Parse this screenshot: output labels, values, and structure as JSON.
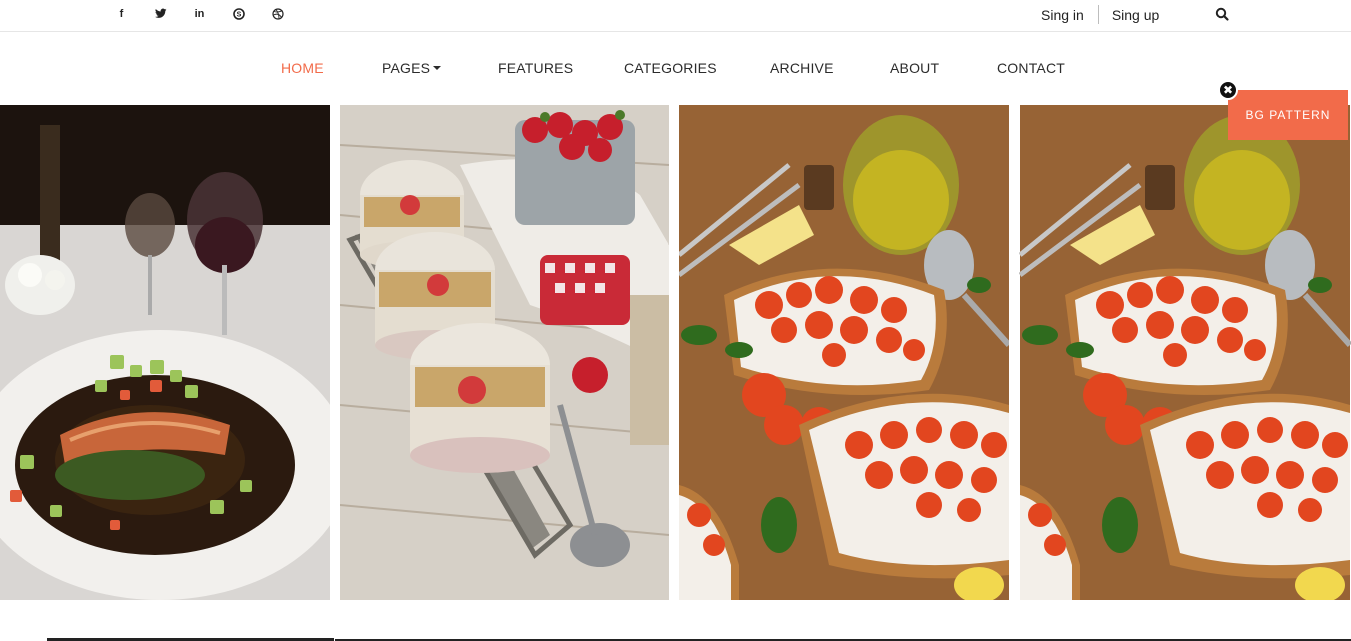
{
  "topbar": {
    "social_icons": [
      "facebook-icon",
      "twitter-icon",
      "linkedin-icon",
      "skype-icon",
      "dribbble-icon"
    ],
    "social_glyphs": [
      "f",
      "",
      "in",
      "S",
      ""
    ],
    "signin_label": "Sing in",
    "signup_label": "Sing up",
    "search_icon": "search-icon"
  },
  "nav": {
    "items": [
      {
        "label": "HOME",
        "active": true
      },
      {
        "label": "PAGES",
        "dropdown": true
      },
      {
        "label": "FEATURES"
      },
      {
        "label": "CATEGORIES"
      },
      {
        "label": "ARCHIVE"
      },
      {
        "label": "ABOUT"
      },
      {
        "label": "CONTACT"
      }
    ]
  },
  "gallery": {
    "tiles": [
      "salmon-dish-photo",
      "oat-parfait-photo",
      "bruschetta-photo",
      "bruschetta-photo-2"
    ]
  },
  "bg_pattern": {
    "label": "BG PATTERN",
    "close_icon": "close-icon"
  },
  "colors": {
    "accent": "#f26b4a",
    "text": "#2b2b2b"
  }
}
